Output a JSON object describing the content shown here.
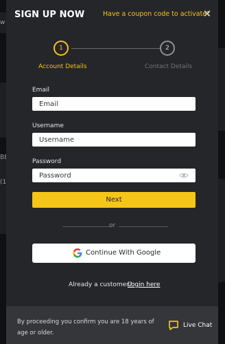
{
  "modal": {
    "title": "SIGN UP NOW",
    "coupon_link": "Have a coupon code to activate?",
    "close_icon": "close-icon"
  },
  "steps": [
    {
      "number": "1",
      "label": "Account Details",
      "active": true
    },
    {
      "number": "2",
      "label": "Contact Details",
      "active": false
    }
  ],
  "fields": {
    "email": {
      "label": "Email",
      "placeholder": "Email",
      "value": ""
    },
    "username": {
      "label": "Username",
      "placeholder": "Username",
      "value": ""
    },
    "password": {
      "label": "Password",
      "placeholder": "Password",
      "value": "",
      "icon": "eye-icon"
    }
  },
  "actions": {
    "next_label": "Next",
    "or_label": "or",
    "google_label": "Continue With Google",
    "google_icon": "google-icon",
    "already_text": "Already a customer?",
    "login_link": "Login here"
  },
  "footer": {
    "age_notice": "By proceeding you confirm you are 18 years of age or older.",
    "live_chat_label": "Live Chat",
    "live_chat_icon": "chat-icon"
  },
  "background": {
    "visible_text": [
      "w",
      "BE",
      "(1"
    ]
  },
  "colors": {
    "accent": "#f5c518",
    "modal_bg": "#252629",
    "footer_bg": "#34363a",
    "page_bg": "#0f1011"
  }
}
